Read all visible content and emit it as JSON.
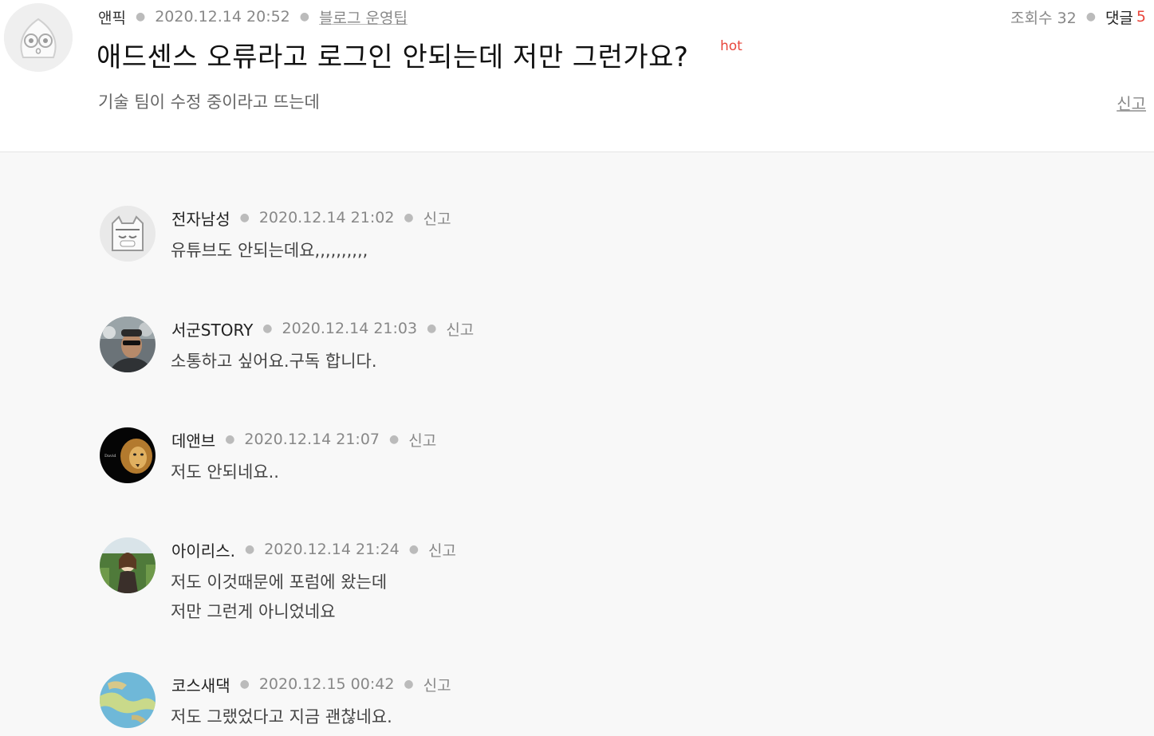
{
  "post": {
    "author": "앤픽",
    "date": "2020.12.14 20:52",
    "category": "블로그 운영팁",
    "views_label": "조회수 32",
    "reply_label": "댓글",
    "reply_count": "5",
    "title": "애드센스 오류라고 로그인 안되는데 저만 그런가요?",
    "hot_badge": "hot",
    "body": "기술 팀이 수정 중이라고 뜨는데",
    "report_label": "신고"
  },
  "comments": [
    {
      "name": "전자남성",
      "date": "2020.12.14 21:02",
      "report": "신고",
      "text": "유튜브도 안되는데요,,,,,,,,,,"
    },
    {
      "name": "서군STORY",
      "date": "2020.12.14 21:03",
      "report": "신고",
      "text": "소통하고 싶어요.구독 합니다."
    },
    {
      "name": "데앤브",
      "date": "2020.12.14 21:07",
      "report": "신고",
      "text": "저도 안되네요.."
    },
    {
      "name": "아이리스.",
      "date": "2020.12.14 21:24",
      "report": "신고",
      "text": "저도 이것때문에 포럼에 왔는데\n저만 그런게 아니었네요"
    },
    {
      "name": "코스새댁",
      "date": "2020.12.15 00:42",
      "report": "신고",
      "text": "저도 그랬었다고 지금 괜찮네요."
    }
  ]
}
